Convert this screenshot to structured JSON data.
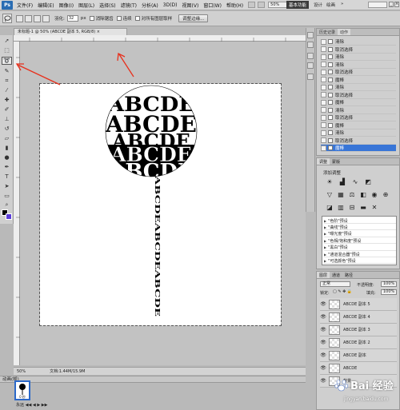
{
  "menu": {
    "logo": "Ps",
    "items": [
      "文件(F)",
      "编辑(E)",
      "图像(I)",
      "图层(L)",
      "选择(S)",
      "滤镜(T)",
      "分析(A)",
      "3D(D)",
      "视图(V)",
      "窗口(W)",
      "帮助(H)"
    ],
    "zoom": "50%",
    "workspace_active": "基本功能",
    "workspace_tabs": [
      "设计",
      "绘画"
    ],
    "window_controls": [
      "_",
      "□",
      "×"
    ]
  },
  "options": {
    "feather_label": "羽化:",
    "feather_value": "32",
    "feather_unit": "px",
    "antialias_label": "消除锯齿",
    "contiguous_label": "连续",
    "all_layers_label": "对所有图层取样",
    "refine_label": "调整边缘..."
  },
  "document": {
    "tab_title": "未标题-1 @ 50% (ABCDE 副本 5, RGB/8) ×",
    "art_text": "ABCDE",
    "stem_text": "ABCDEABCDEABCDE"
  },
  "status": {
    "zoom": "50%",
    "doc_info": "文档:1.44M/15.9M"
  },
  "animation": {
    "header": "动画(帧)",
    "frame_time": "0 秒",
    "loop": "永远"
  },
  "history": {
    "tabs": [
      "历史记录",
      "动作"
    ],
    "rows": [
      {
        "label": "清除",
        "selected": false
      },
      {
        "label": "取消选择",
        "selected": false
      },
      {
        "label": "清除",
        "selected": false
      },
      {
        "label": "清除",
        "selected": false
      },
      {
        "label": "取消选择",
        "selected": false
      },
      {
        "label": "魔棒",
        "selected": false
      },
      {
        "label": "清除",
        "selected": false
      },
      {
        "label": "取消选择",
        "selected": false
      },
      {
        "label": "魔棒",
        "selected": false
      },
      {
        "label": "清除",
        "selected": false
      },
      {
        "label": "取消选择",
        "selected": false
      },
      {
        "label": "魔棒",
        "selected": false
      },
      {
        "label": "清除",
        "selected": false
      },
      {
        "label": "取消选择",
        "selected": false
      },
      {
        "label": "魔棒",
        "selected": true
      }
    ]
  },
  "adjustments": {
    "tabs": [
      "调整",
      "蒙版"
    ],
    "title": "添加调整",
    "presets": [
      "\"色阶\"预设",
      "\"曲线\"预设",
      "\"曝光度\"预设",
      "\"色相/饱和度\"预设",
      "\"黑白\"预设",
      "\"通道混合器\"预设",
      "\"可选颜色\"预设"
    ]
  },
  "layers": {
    "tabs": [
      "图层",
      "通道",
      "路径"
    ],
    "blend_mode": "正常",
    "opacity_label": "不透明度:",
    "opacity": "100%",
    "lock_label": "锁定:",
    "fill_label": "填充:",
    "fill": "100%",
    "rows": [
      "ABCDE 副本 5",
      "ABCDE 副本 4",
      "ABCDE 副本 3",
      "ABCDE 副本 2",
      "ABCDE 副本",
      "ABCDE",
      "背景"
    ]
  },
  "watermark": {
    "brand": "Bai 经验",
    "url": "jingyan.baidu.com"
  },
  "colors": {
    "accent": "#3875d7",
    "foreground": "#000000",
    "background": "#5b3dd8",
    "arrow": "#e8301c"
  }
}
